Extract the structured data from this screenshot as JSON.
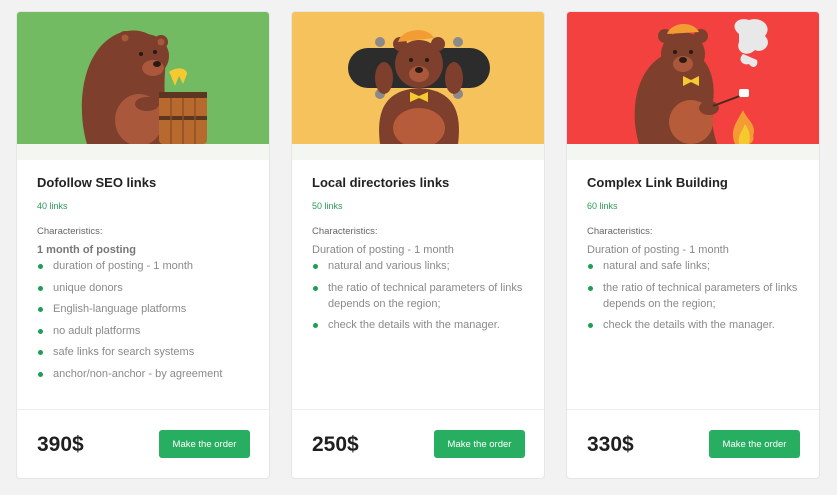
{
  "colors": {
    "hero_green": "#72bb62",
    "hero_yellow": "#f5c25c",
    "hero_red": "#f3413f",
    "button": "#27ae60",
    "links_count": "#2e9a57",
    "bullet": "#1e9e55"
  },
  "cards": [
    {
      "illustration": "bear-with-honey-barrel",
      "title": "Dofollow SEO links",
      "links_count": "40 links",
      "characteristics_label": "Characteristics:",
      "duration": "1 month of posting",
      "features": [
        "duration of posting - 1 month",
        "unique donors",
        "English-language platforms",
        "no adult platforms",
        "safe links for search systems",
        "anchor/non-anchor - by agreement"
      ],
      "price": "390$",
      "button_label": "Make the order"
    },
    {
      "illustration": "bear-with-skateboard",
      "title": "Local directories links",
      "links_count": "50 links",
      "characteristics_label": "Characteristics:",
      "duration": "Duration of posting - 1 month",
      "features": [
        "natural and various links;",
        "the ratio of technical parameters of links depends on the region;",
        "check the details with the manager."
      ],
      "price": "250$",
      "button_label": "Make the order"
    },
    {
      "illustration": "bear-roasting-marshmallow",
      "title": "Complex Link Building",
      "links_count": "60 links",
      "characteristics_label": "Characteristics:",
      "duration": "Duration of posting - 1 month",
      "features": [
        "natural and safe links;",
        "the ratio of technical parameters of links depends on the region;",
        "check the details with the manager."
      ],
      "price": "330$",
      "button_label": "Make the order"
    }
  ]
}
